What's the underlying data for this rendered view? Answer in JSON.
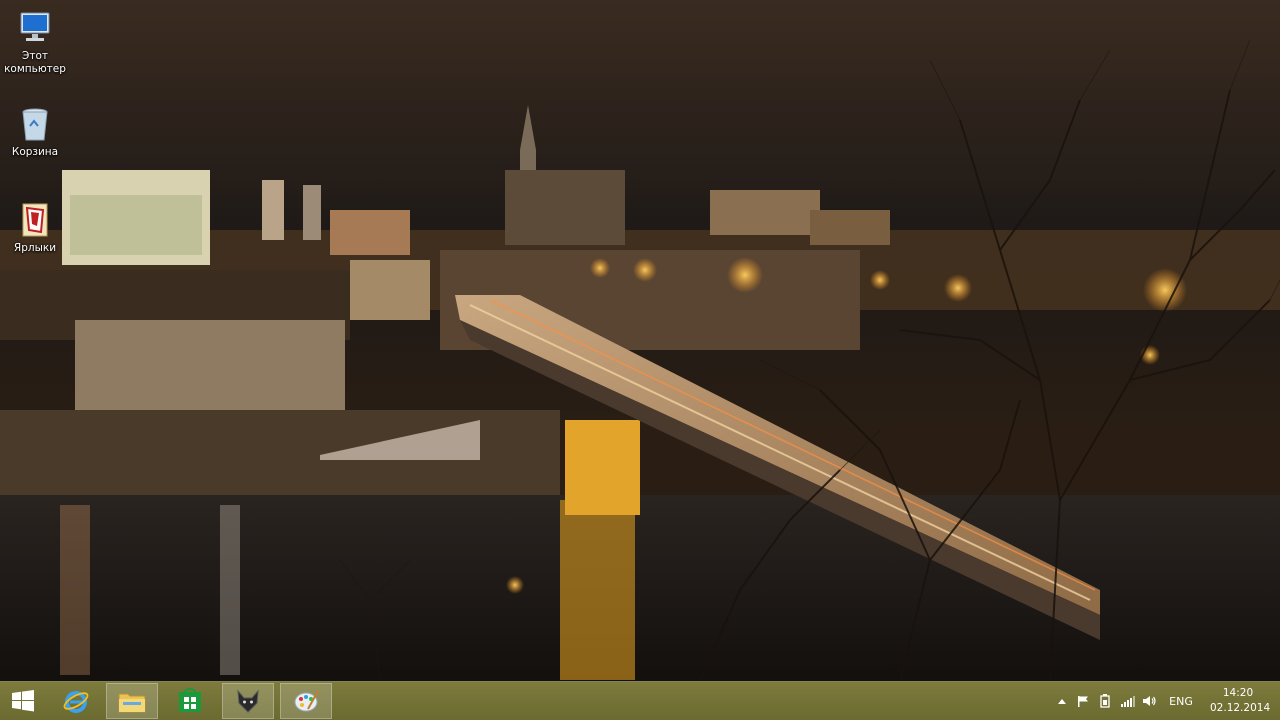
{
  "desktop": {
    "icons": [
      {
        "id": "this-pc",
        "label": "Этот компьютер",
        "icon": "computer-icon"
      },
      {
        "id": "recycle-bin",
        "label": "Корзина",
        "icon": "recycle-bin-icon"
      },
      {
        "id": "shortcuts",
        "label": "Ярлыки",
        "icon": "folder-shortcuts-icon"
      }
    ]
  },
  "taskbar": {
    "start_icon": "windows-start-icon",
    "pinned": [
      {
        "id": "internet-explorer",
        "icon": "internet-explorer-icon"
      },
      {
        "id": "file-explorer",
        "icon": "file-explorer-icon",
        "active": true
      },
      {
        "id": "store",
        "icon": "windows-store-icon"
      },
      {
        "id": "foobar",
        "icon": "fox-app-icon"
      },
      {
        "id": "paint",
        "icon": "paint-palette-icon"
      }
    ],
    "tray": {
      "language": "ENG",
      "time": "14:20",
      "date": "02.12.2014"
    }
  },
  "colors": {
    "taskbar": "#75743a",
    "text": "#ffffff"
  }
}
